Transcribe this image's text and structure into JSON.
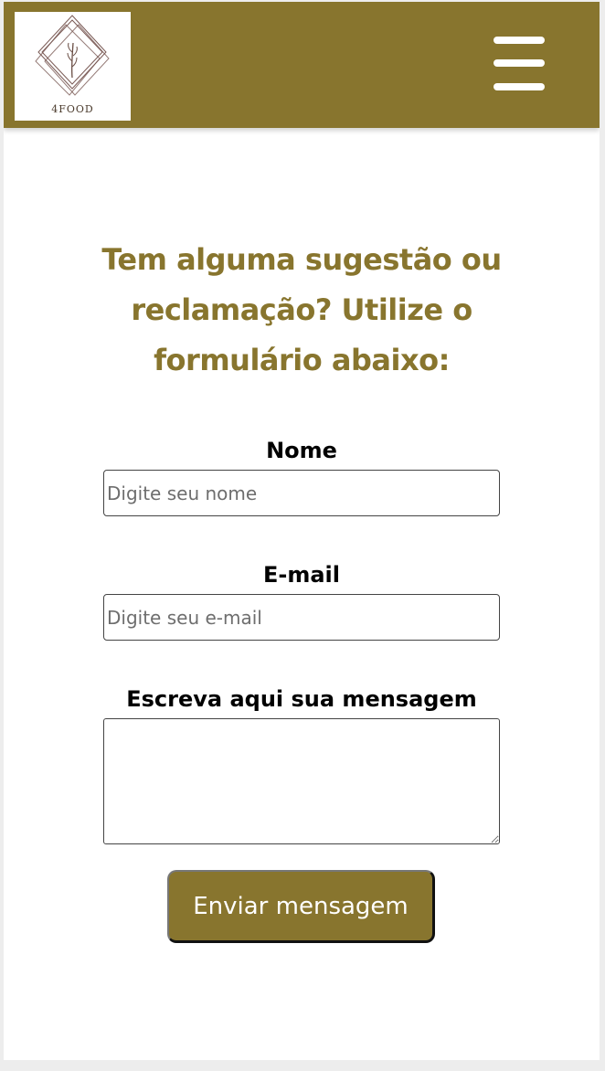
{
  "header": {
    "logo_text": "4FOOD",
    "logo_icon": "leaf-diamond-logo",
    "menu_icon": "hamburger-icon",
    "background_color": "#88752e"
  },
  "main": {
    "heading": "Tem alguma sugestão ou reclamação? Utilize o formulário abaixo:",
    "heading_color": "#88752e"
  },
  "form": {
    "name_label": "Nome",
    "name_placeholder": "Digite seu nome",
    "email_label": "E-mail",
    "email_placeholder": "Digite seu e-mail",
    "message_label": "Escreva aqui sua mensagem",
    "submit_label": "Enviar mensagem"
  }
}
